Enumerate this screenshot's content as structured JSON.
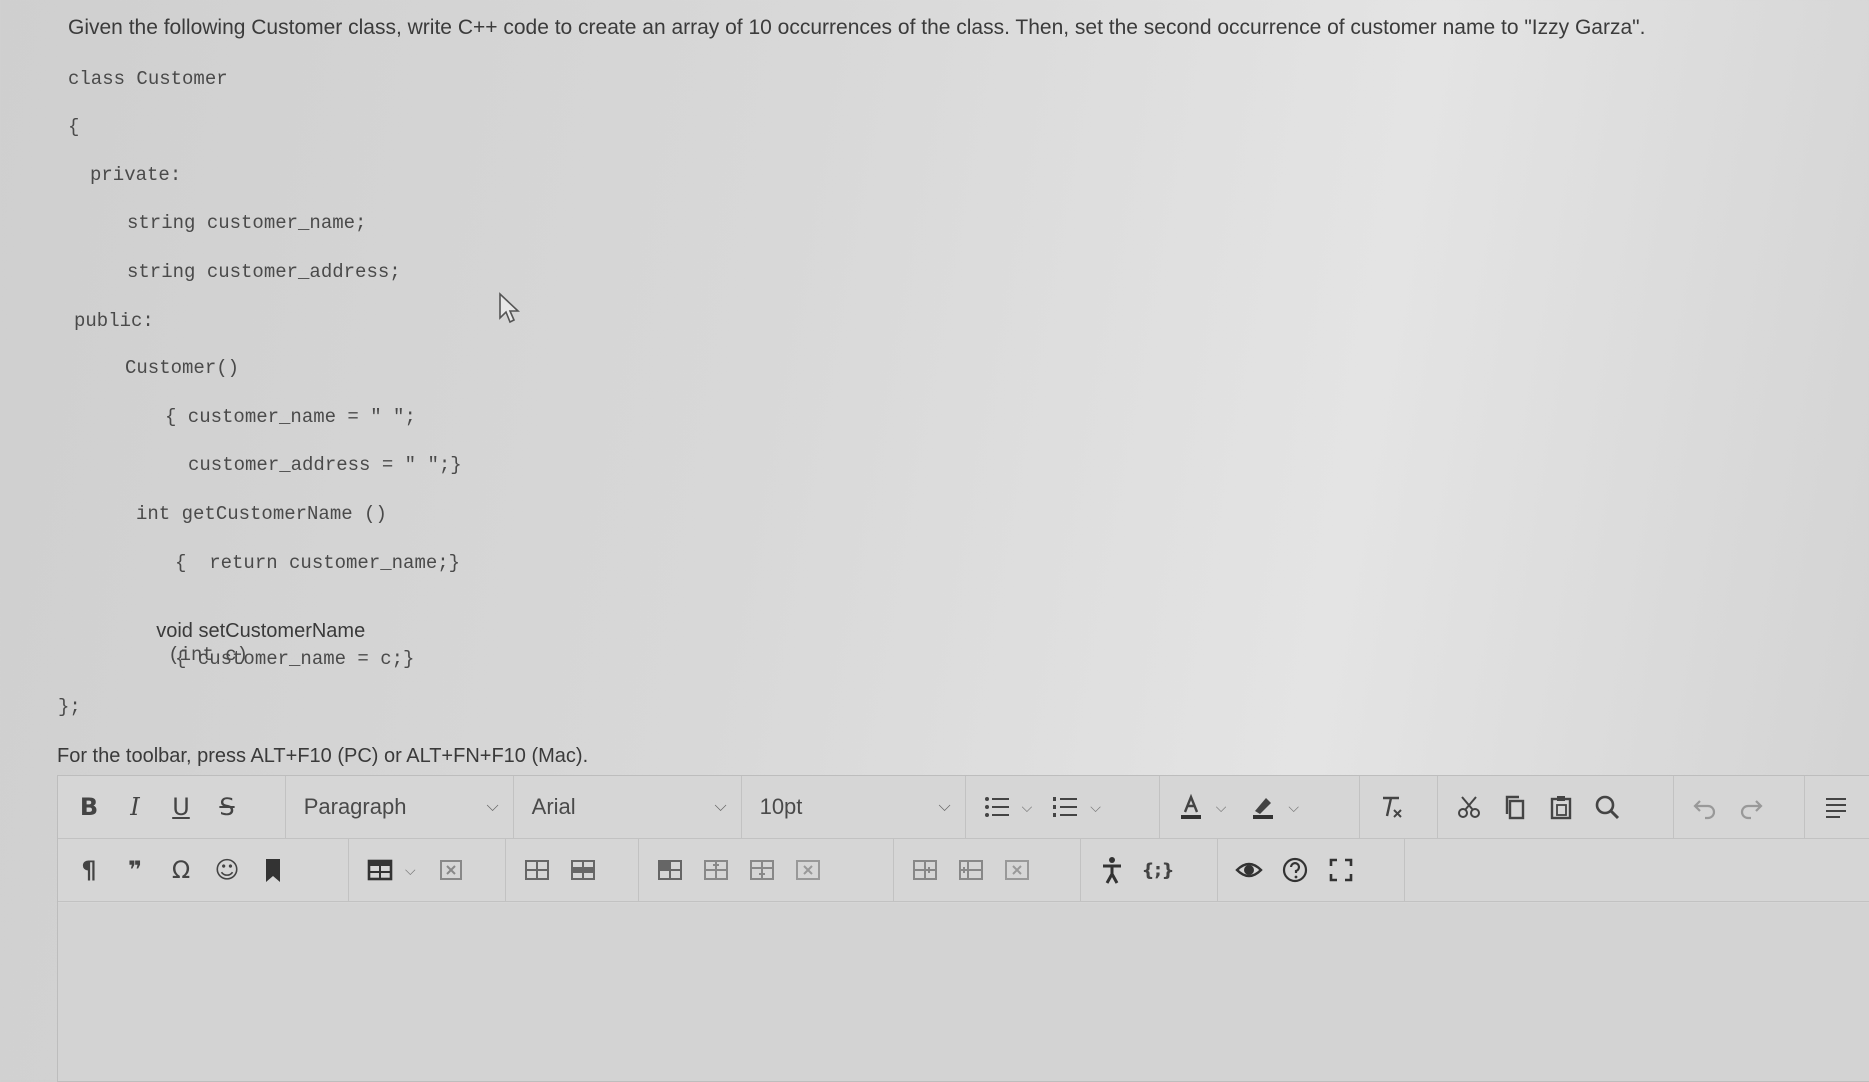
{
  "question": "Given the following Customer class, write C++ code to create an array of 10 occurrences of the class.   Then, set  the second occurrence of customer name to \"Izzy Garza\".",
  "code": {
    "line1": "class Customer",
    "line2": "{",
    "line3": "private:",
    "line4": "string customer_name;",
    "line5": "string customer_address;",
    "line6": "public:",
    "line7": "Customer()",
    "line8": "{ customer_name = \" \";",
    "line9": "customer_address = \" \";}",
    "line10": "int getCustomerName ()",
    "line11": "{  return customer_name;}",
    "line12a": "void setCustomerName",
    "line12b": "(int c)",
    "line13": "{ customer_name = c;}",
    "line14": "};"
  },
  "toolbar_note": "For the toolbar, press ALT+F10 (PC) or ALT+FN+F10 (Mac).",
  "toolbar": {
    "bold": "B",
    "italic": "I",
    "underline": "U",
    "strike": "S",
    "paragraph_select": "Paragraph",
    "font_select": "Arial",
    "size_select": "10pt",
    "paragraph_mark": "¶",
    "quote": "❞",
    "omega": "Ω",
    "emoji": "☺",
    "source_code": "{;}"
  },
  "icons": [
    "bullet-list-icon",
    "numbered-list-icon",
    "text-color-icon",
    "highlight-icon",
    "clear-format-icon",
    "cut-icon",
    "copy-icon",
    "paste-icon",
    "search-icon",
    "undo-icon",
    "redo-icon",
    "align-icon",
    "bookmark-icon",
    "table-icon",
    "accessibility-icon",
    "preview-icon",
    "help-icon",
    "fullscreen-icon"
  ]
}
